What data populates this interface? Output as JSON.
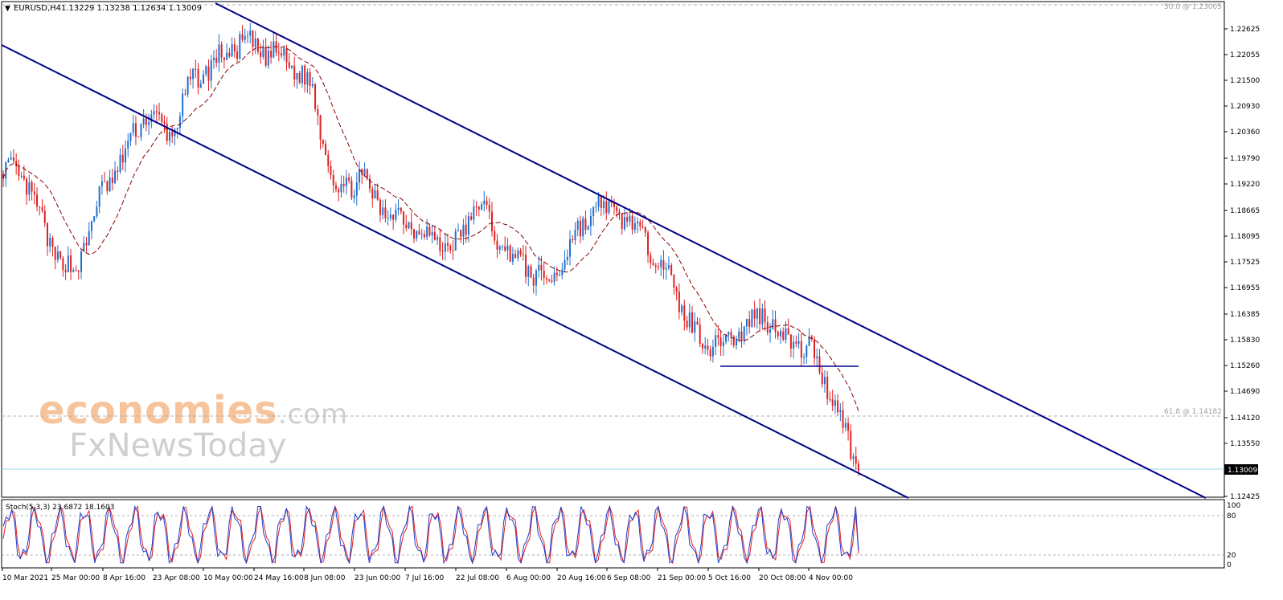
{
  "header": {
    "symbol": "EURUSD,H4",
    "ohlc": "1.13229 1.13238 1.12634 1.13009"
  },
  "stoch_header": "Stoch(5,3,3) 23.6872 18.1603",
  "fib_labels": {
    "top": "50.0 @ 1.23005",
    "mid": "61.8 @ 1.14182"
  },
  "current_price_label": "1.13009",
  "watermark": {
    "line1": "economies",
    "line1_suffix": ".com",
    "line2": "FxNewsToday"
  },
  "colors": {
    "up_candle": "#1f6fd1",
    "down_candle": "#e02020",
    "channel": "#00008b",
    "ma": "#8b0000",
    "stoch_main": "#1f3fd0",
    "stoch_signal": "#e02020",
    "price_line": "#9fd3e8",
    "fib_line": "#b0b0b0",
    "watermark_orange": "#f6c39a",
    "watermark_gray": "#cfcfcf"
  },
  "chart_data": [
    {
      "type": "candlestick",
      "symbol": "EURUSD",
      "timeframe": "H4",
      "ylim": [
        1.12425,
        1.23005
      ],
      "y_ticks": [
        "1.22625",
        "1.22055",
        "1.21500",
        "1.20930",
        "1.20360",
        "1.19790",
        "1.19220",
        "1.18665",
        "1.18095",
        "1.17525",
        "1.16955",
        "1.16385",
        "1.15830",
        "1.15260",
        "1.14690",
        "1.14120",
        "1.13550",
        "1.12425"
      ],
      "x_ticks": [
        "10 Mar 2021",
        "25 Mar 00:00",
        "8 Apr 16:00",
        "23 Apr 08:00",
        "10 May 00:00",
        "24 May 16:00",
        "8 Jun 08:00",
        "23 Jun 00:00",
        "7 Jul 16:00",
        "22 Jul 08:00",
        "6 Aug 00:00",
        "20 Aug 16:00",
        "6 Sep 08:00",
        "21 Sep 00:00",
        "5 Oct 16:00",
        "20 Oct 08:00",
        "4 Nov 00:00"
      ],
      "closes_approx": [
        [
          "10 Mar 2021",
          1.195
        ],
        [
          "17 Mar 2021",
          1.192
        ],
        [
          "25 Mar 00:00",
          1.178
        ],
        [
          "31 Mar 2021",
          1.172
        ],
        [
          "8 Apr 16:00",
          1.188
        ],
        [
          "15 Apr 2021",
          1.197
        ],
        [
          "23 Apr 08:00",
          1.207
        ],
        [
          "30 Apr 2021",
          1.202
        ],
        [
          "10 May 00:00",
          1.214
        ],
        [
          "17 May 2021",
          1.218
        ],
        [
          "24 May 16:00",
          1.222
        ],
        [
          "31 May 2021",
          1.22
        ],
        [
          "8 Jun 08:00",
          1.218
        ],
        [
          "15 Jun 2021",
          1.212
        ],
        [
          "18 Jun 2021",
          1.19
        ],
        [
          "23 Jun 00:00",
          1.193
        ],
        [
          "30 Jun 2021",
          1.186
        ],
        [
          "7 Jul 16:00",
          1.184
        ],
        [
          "15 Jul 2021",
          1.18
        ],
        [
          "22 Jul 08:00",
          1.178
        ],
        [
          "29 Jul 2021",
          1.188
        ],
        [
          "6 Aug 00:00",
          1.178
        ],
        [
          "13 Aug 2021",
          1.174
        ],
        [
          "20 Aug 16:00",
          1.17
        ],
        [
          "27 Aug 2021",
          1.18
        ],
        [
          "1 Sep 2021",
          1.187
        ],
        [
          "6 Sep 08:00",
          1.185
        ],
        [
          "14 Sep 2021",
          1.18
        ],
        [
          "21 Sep 00:00",
          1.172
        ],
        [
          "29 Sep 2021",
          1.16
        ],
        [
          "5 Oct 16:00",
          1.157
        ],
        [
          "12 Oct 2021",
          1.16
        ],
        [
          "20 Oct 08:00",
          1.164
        ],
        [
          "27 Oct 2021",
          1.158
        ],
        [
          "4 Nov 00:00",
          1.156
        ],
        [
          "10 Nov 2021",
          1.145
        ],
        [
          "12 Nov 2021",
          1.1301
        ]
      ],
      "channel": {
        "upper": [
          [
            "24 May 2021",
            1.23
          ],
          [
            "4 Nov 2021",
            1.16
          ]
        ],
        "lower": [
          [
            "10 Mar 2021",
            1.22
          ],
          [
            "12 Nov 2021",
            1.1301
          ]
        ]
      },
      "horizontal_line": 1.1532,
      "moving_average": "dashed",
      "fib_levels": [
        {
          "label": "50.0 @ 1.23005",
          "value": 1.23005
        },
        {
          "label": "61.8 @ 1.14182",
          "value": 1.14182
        }
      ],
      "current_price": 1.13009
    },
    {
      "type": "line",
      "name": "Stoch(5,3,3)",
      "series": [
        {
          "name": "main",
          "last": 23.6872
        },
        {
          "name": "signal",
          "last": 18.1603
        }
      ],
      "ylim": [
        0,
        100
      ],
      "y_ticks": [
        "100",
        "80",
        "20",
        "0"
      ],
      "levels": [
        80,
        20
      ]
    }
  ]
}
